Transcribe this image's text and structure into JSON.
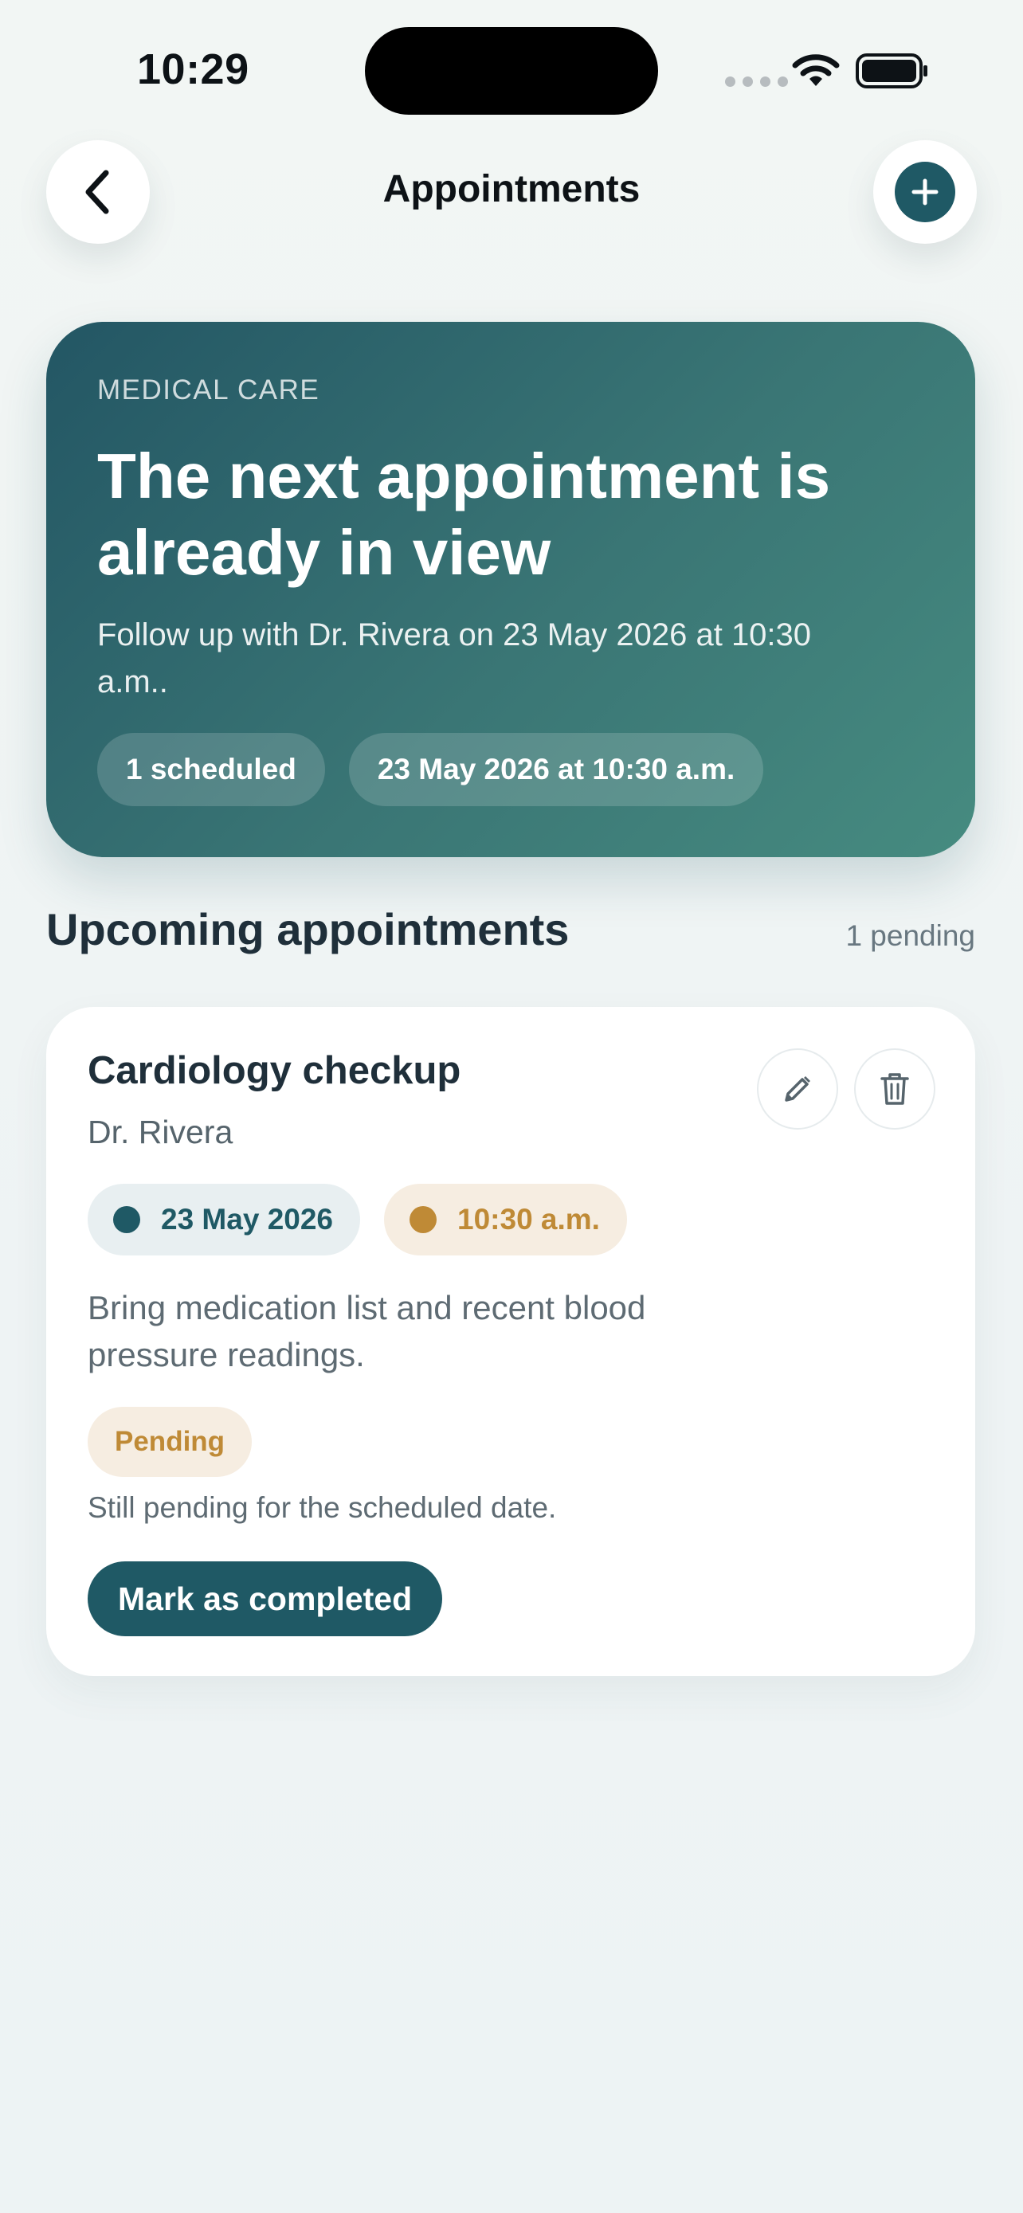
{
  "status_bar": {
    "time": "10:29"
  },
  "header": {
    "title": "Appointments",
    "back_icon": "chevron-left-icon",
    "add_icon": "plus-icon"
  },
  "hero": {
    "kicker": "MEDICAL CARE",
    "title": "The next appointment is already in view",
    "subtitle": "Follow up with Dr. Rivera on 23 May 2026 at 10:30 a.m..",
    "chips": [
      {
        "label": "1 scheduled"
      },
      {
        "label": "23 May 2026 at 10:30 a.m."
      }
    ]
  },
  "section": {
    "title": "Upcoming appointments",
    "count": "1 pending"
  },
  "appointments": [
    {
      "title": "Cardiology checkup",
      "doctor": "Dr. Rivera",
      "date": "23 May 2026",
      "time": "10:30 a.m.",
      "notes": "Bring medication list and recent blood pressure readings.",
      "status": "Pending",
      "status_note": "Still pending for the scheduled date.",
      "action_label": "Mark as completed",
      "edit_icon": "pencil-icon",
      "delete_icon": "trash-icon"
    }
  ],
  "colors": {
    "primary": "#1f5965",
    "hero_gradient_start": "#235664",
    "hero_gradient_end": "#468b80",
    "accent_amber": "#bf8a36",
    "pending_bg": "#f6ede1",
    "date_chip_bg": "#e8eff1",
    "text_dark": "#1f2f3a",
    "text_muted": "#5e6b73"
  }
}
